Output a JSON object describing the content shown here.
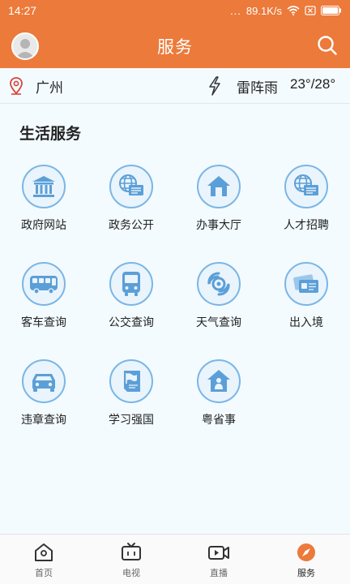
{
  "status_bar": {
    "time": "14:27",
    "dots": "...",
    "speed": "89.1K/s"
  },
  "header": {
    "title": "服务"
  },
  "location_bar": {
    "city": "广州",
    "weather": "雷阵雨",
    "temperature": "23°/28°"
  },
  "section": {
    "title": "生活服务"
  },
  "services": [
    {
      "label": "政府网站",
      "icon": "government-building-icon"
    },
    {
      "label": "政务公开",
      "icon": "globe-document-icon"
    },
    {
      "label": "办事大厅",
      "icon": "house-icon"
    },
    {
      "label": "人才招聘",
      "icon": "globe-document-icon"
    },
    {
      "label": "客车查询",
      "icon": "coach-bus-icon"
    },
    {
      "label": "公交查询",
      "icon": "city-bus-icon"
    },
    {
      "label": "天气查询",
      "icon": "typhoon-icon"
    },
    {
      "label": "出入境",
      "icon": "passport-card-icon"
    },
    {
      "label": "违章查询",
      "icon": "car-icon"
    },
    {
      "label": "学习强国",
      "icon": "flag-book-icon"
    },
    {
      "label": "粤省事",
      "icon": "person-house-icon"
    }
  ],
  "bottom_nav": [
    {
      "label": "首页",
      "icon": "home-icon"
    },
    {
      "label": "电视",
      "icon": "tv-icon"
    },
    {
      "label": "直播",
      "icon": "video-camera-icon"
    },
    {
      "label": "服务",
      "icon": "compass-icon",
      "active": true
    }
  ],
  "colors": {
    "brand": "#ec7a3a",
    "icon_blue": "#7ab6e6",
    "icon_fill": "#5b9fd8",
    "background": "#f3fbff"
  }
}
